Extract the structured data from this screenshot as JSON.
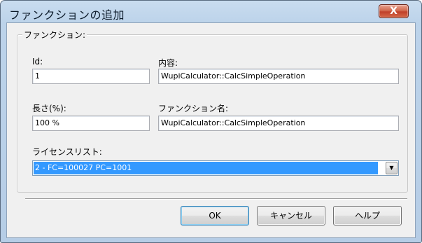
{
  "window": {
    "title": "ファンクションの追加",
    "close_glyph": "X"
  },
  "group": {
    "legend": "ファンクション:"
  },
  "fields": {
    "id": {
      "label": "Id:",
      "value": "1"
    },
    "content": {
      "label": "内容:",
      "value": "WupiCalculator::CalcSimpleOperation"
    },
    "length": {
      "label": "長さ(%):",
      "value": "100 %"
    },
    "function_name": {
      "label": "ファンクション名:",
      "value": "WupiCalculator::CalcSimpleOperation"
    }
  },
  "license_list": {
    "label": "ライセンスリスト:",
    "selected": "2 - FC=100027 PC=1001"
  },
  "buttons": {
    "ok": "OK",
    "cancel": "キャンセル",
    "help": "ヘルプ"
  },
  "colors": {
    "selection": "#3399ff",
    "close_button": "#c0402a",
    "title_bar": "#bcd3ea"
  }
}
